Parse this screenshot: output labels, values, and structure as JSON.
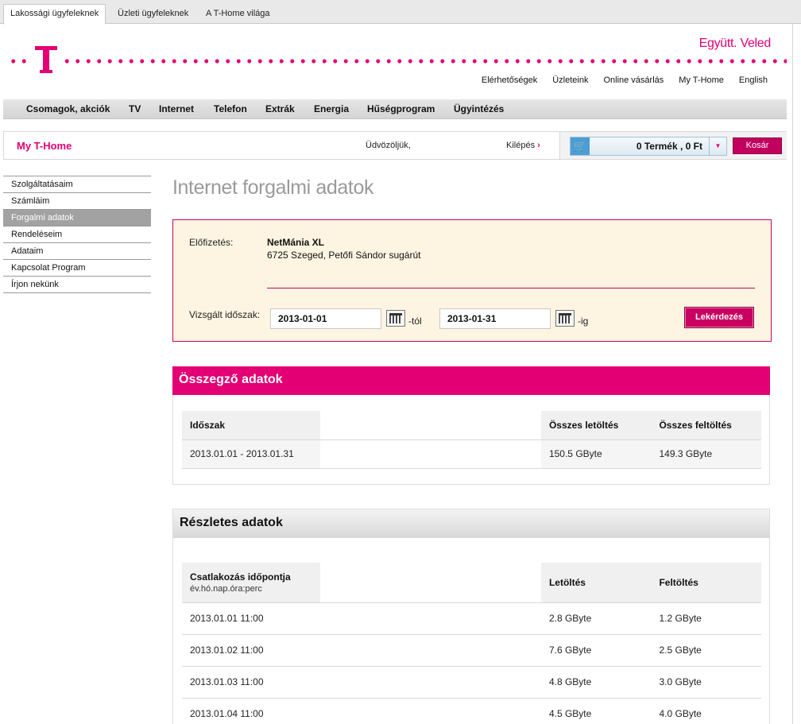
{
  "segments": [
    "Lakossági ügyfeleknek",
    "Üzleti ügyfeleknek",
    "A T-Home világa"
  ],
  "slogan": "Együtt. Veled",
  "utility_nav": [
    "Elérhetőségek",
    "Üzleteink",
    "Online vásárlás",
    "My T-Home",
    "English"
  ],
  "main_nav": [
    "Csomagok, akciók",
    "TV",
    "Internet",
    "Telefon",
    "Extrák",
    "Energia",
    "Hűségprogram",
    "Ügyintézés"
  ],
  "mybar": {
    "title": "My T-Home",
    "welcome": "Üdvözöljük,",
    "logout": "Kilépés",
    "cart_text": "0 Termék , 0 Ft",
    "cart_button": "Kosár"
  },
  "sidebar": [
    {
      "label": "Szolgáltatásaim",
      "active": false
    },
    {
      "label": "Számláim",
      "active": false
    },
    {
      "label": "Forgalmi adatok",
      "active": true
    },
    {
      "label": "Rendeléseim",
      "active": false
    },
    {
      "label": "Adataim",
      "active": false
    },
    {
      "label": "Kapcsolat Program",
      "active": false
    },
    {
      "label": "Írjon nekünk",
      "active": false
    }
  ],
  "page_title": "Internet forgalmi adatok",
  "filter": {
    "subscription_label": "Előfizetés:",
    "plan": "NetMánia XL",
    "address": "6725 Szeged, Petőfi Sándor sugárút",
    "period_label": "Vizsgált időszak:",
    "date_from": "2013-01-01",
    "from_suffix": "-tól",
    "date_to": "2013-01-31",
    "to_suffix": "-ig",
    "query_button": "Lekérdezés"
  },
  "summary": {
    "title": "Összegző adatok",
    "headers": [
      "Időszak",
      "Összes letöltés",
      "Összes feltöltés"
    ],
    "row": [
      "2013.01.01 -  2013.01.31",
      "150.5 GByte",
      "149.3 GByte"
    ]
  },
  "details": {
    "title": "Részletes adatok",
    "headers": [
      "Csatlakozás időpontja",
      "Letöltés",
      "Feltöltés"
    ],
    "header_sub": "év.hó.nap.óra:perc",
    "rows": [
      [
        "2013.01.01 11:00",
        "2.8 GByte",
        "1.2 GByte"
      ],
      [
        "2013.01.02 11:00",
        "7.6 GByte",
        "2.5 GByte"
      ],
      [
        "2013.01.03 11:00",
        "4.8 GByte",
        "3.0 GByte"
      ],
      [
        "2013.01.04 11:00",
        "4.5 GByte",
        "4.0 GByte"
      ]
    ]
  },
  "colors": {
    "brand": "#e20074",
    "sidebar_active": "#a2a2a2",
    "filter_bg": "#fdf5e2"
  }
}
